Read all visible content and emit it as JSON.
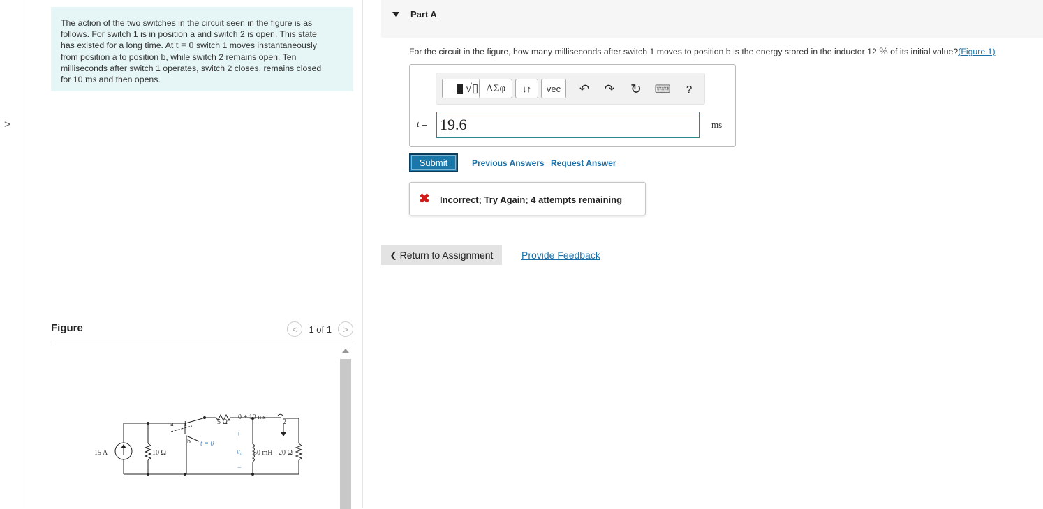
{
  "nav": {
    "expand_glyph": ">"
  },
  "problem": {
    "line1": "The action of the two switches in the circuit seen in the figure is as",
    "line2": "follows. For switch 1 is in position a and switch 2 is open. This state",
    "line3a": "has existed for a long time. At ",
    "line3_math": "t = 0",
    "line3b": " switch 1 moves instantaneously",
    "line4": "from position a to position b, while switch 2 remains open. Ten",
    "line5": "milliseconds after switch 1 operates, switch 2 closes, remains closed",
    "line6a": "for 10 ",
    "line6_math": "ms",
    "line6b": " and then opens."
  },
  "figure": {
    "title": "Figure",
    "page_indicator": "1 of 1",
    "prev_glyph": "<",
    "next_glyph": ">",
    "circuit": {
      "source_label": "15 A",
      "r1_label": "10 Ω",
      "r2_label": "5 Ω",
      "switch_label": "0 + 10 ms",
      "sw1_pos_a": "a",
      "sw1_number": "1",
      "sw1_pos_b": "b",
      "sw1_time": "t = 0",
      "sw2_number": "2",
      "voltage_label": "v₀",
      "plus": "+",
      "minus": "−",
      "inductor_label": "50 mH",
      "r3_label": "20 Ω"
    }
  },
  "part": {
    "title": "Part A",
    "question_a": "For the circuit in the figure, how many milliseconds after switch 1 moves to position b is the energy stored in the inductor 12 ",
    "question_pct": "%",
    "question_b": " of its initial value?",
    "figure_link": "(Figure 1)"
  },
  "toolbar": {
    "templates": "√▯",
    "greek": "ΑΣφ",
    "arrows": "↓↑",
    "vec": "vec",
    "undo": "↶",
    "redo": "↷",
    "reset": "↻",
    "keyboard": "⌨",
    "help": "?"
  },
  "answer": {
    "variable": "t",
    "equals": " =",
    "value": "19.6",
    "unit": "ms"
  },
  "actions": {
    "submit": "Submit",
    "previous_answers": "Previous Answers",
    "request_answer": "Request Answer"
  },
  "feedback": {
    "icon": "✖",
    "message": "Incorrect; Try Again; 4 attempts remaining"
  },
  "footer": {
    "return": "Return to Assignment",
    "return_glyph": "❮",
    "provide_feedback": "Provide Feedback"
  },
  "colors": {
    "accent": "#1c77a9",
    "error": "#d01919",
    "problem_bg": "#e6f5f5"
  }
}
